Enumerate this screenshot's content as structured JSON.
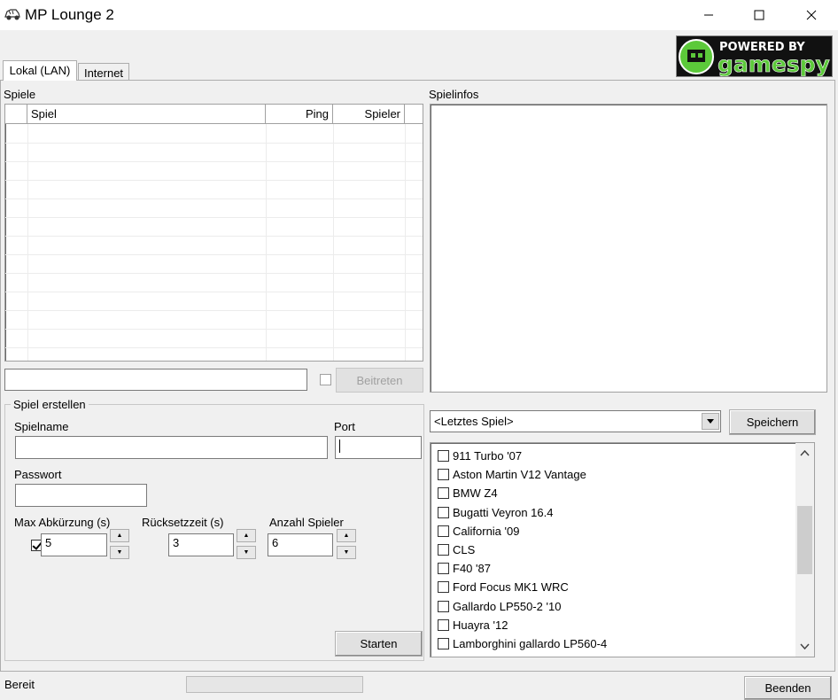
{
  "window": {
    "title": "MP Lounge 2"
  },
  "tabs": [
    {
      "label": "Lokal (LAN)",
      "active": true
    },
    {
      "label": "Internet",
      "active": false
    }
  ],
  "games": {
    "label": "Spiele",
    "columns": [
      "Spiel",
      "Ping",
      "Spieler"
    ],
    "rows": []
  },
  "info": {
    "label": "Spielinfos"
  },
  "join": {
    "input_value": "",
    "checkbox_checked": false,
    "button_label": "Beitreten"
  },
  "create": {
    "group_label": "Spiel erstellen",
    "name_label": "Spielname",
    "name_value": "",
    "port_label": "Port",
    "port_value": "",
    "password_label": "Passwort",
    "password_value": "",
    "max_shortcut": {
      "label": "Max Abkürzung (s)",
      "checked": true,
      "value": "5"
    },
    "reset_time": {
      "label": "Rücksetzzeit (s)",
      "checked": true,
      "value": "3"
    },
    "player_count": {
      "label": "Anzahl Spieler",
      "value": "6"
    },
    "start_label": "Starten"
  },
  "presets": {
    "selected": "<Letztes Spiel>",
    "save_label": "Speichern"
  },
  "cars": [
    "911 Turbo '07",
    "Aston Martin V12 Vantage",
    "BMW Z4",
    "Bugatti Veyron 16.4",
    "California '09",
    "CLS",
    "F40 '87",
    "Ford Focus MK1 WRC",
    "Gallardo LP550-2 '10",
    "Huayra '12",
    "Lamborghini gallardo LP560-4"
  ],
  "status": {
    "text": "Bereit",
    "exit_label": "Beenden"
  },
  "logo": {
    "line1": "POWERED BY",
    "line2": "gamespy"
  }
}
